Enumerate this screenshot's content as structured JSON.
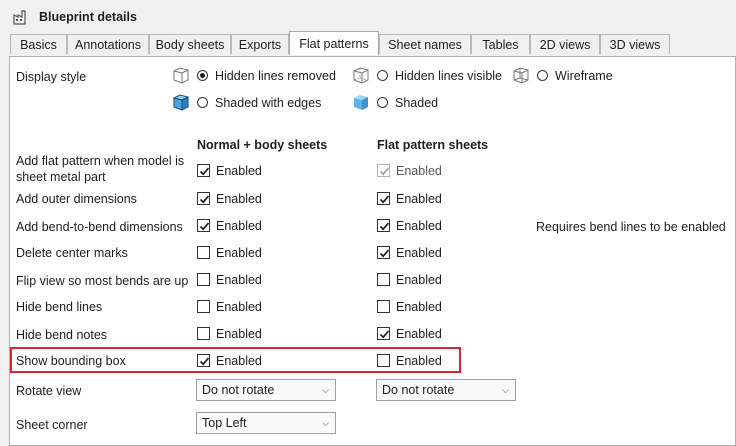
{
  "window": {
    "title": "Blueprint details",
    "title_icon": "factory-icon"
  },
  "tabs": [
    {
      "label": "Basics",
      "active": false
    },
    {
      "label": "Annotations",
      "active": false
    },
    {
      "label": "Body sheets",
      "active": false
    },
    {
      "label": "Exports",
      "active": false
    },
    {
      "label": "Flat patterns",
      "active": true
    },
    {
      "label": "Sheet names",
      "active": false
    },
    {
      "label": "Tables",
      "active": false
    },
    {
      "label": "2D views",
      "active": false
    },
    {
      "label": "3D views",
      "active": false
    }
  ],
  "display_style": {
    "label": "Display style",
    "options": [
      {
        "label": "Hidden lines removed",
        "icon": "cube-hidden-lines-removed-icon",
        "selected": true
      },
      {
        "label": "Hidden lines visible",
        "icon": "cube-hidden-lines-visible-icon",
        "selected": false
      },
      {
        "label": "Wireframe",
        "icon": "cube-wireframe-icon",
        "selected": false
      },
      {
        "label": "Shaded with edges",
        "icon": "cube-shaded-edges-icon",
        "selected": false
      },
      {
        "label": "Shaded",
        "icon": "cube-shaded-icon",
        "selected": false
      }
    ]
  },
  "columns": {
    "normal": "Normal + body sheets",
    "flat": "Flat pattern sheets"
  },
  "enabled_label": "Enabled",
  "rows": [
    {
      "label_line1": "Add flat pattern when model is",
      "label_line2": "sheet metal part",
      "normal": true,
      "flat": true,
      "flat_disabled": true,
      "note": ""
    },
    {
      "label_line1": "Add outer dimensions",
      "label_line2": "",
      "normal": true,
      "flat": true,
      "flat_disabled": false,
      "note": ""
    },
    {
      "label_line1": "Add bend-to-bend dimensions",
      "label_line2": "",
      "normal": true,
      "flat": true,
      "flat_disabled": false,
      "note": "Requires bend lines to be enabled"
    },
    {
      "label_line1": "Delete center marks",
      "label_line2": "",
      "normal": false,
      "flat": true,
      "flat_disabled": false,
      "note": ""
    },
    {
      "label_line1": "Flip view so most bends are up",
      "label_line2": "",
      "normal": false,
      "flat": false,
      "flat_disabled": false,
      "note": ""
    },
    {
      "label_line1": "Hide bend lines",
      "label_line2": "",
      "normal": false,
      "flat": false,
      "flat_disabled": false,
      "note": ""
    },
    {
      "label_line1": "Hide bend notes",
      "label_line2": "",
      "normal": false,
      "flat": true,
      "flat_disabled": false,
      "note": ""
    },
    {
      "label_line1": "Show bounding box",
      "label_line2": "",
      "normal": true,
      "flat": false,
      "flat_disabled": false,
      "note": "",
      "highlighted": true
    }
  ],
  "rotate_view": {
    "label": "Rotate view",
    "normal_value": "Do not rotate",
    "flat_value": "Do not rotate"
  },
  "sheet_corner": {
    "label": "Sheet corner",
    "normal_value": "Top Left"
  },
  "colors": {
    "highlight": "#d9272d",
    "accent_cube": "#4aa3df"
  }
}
